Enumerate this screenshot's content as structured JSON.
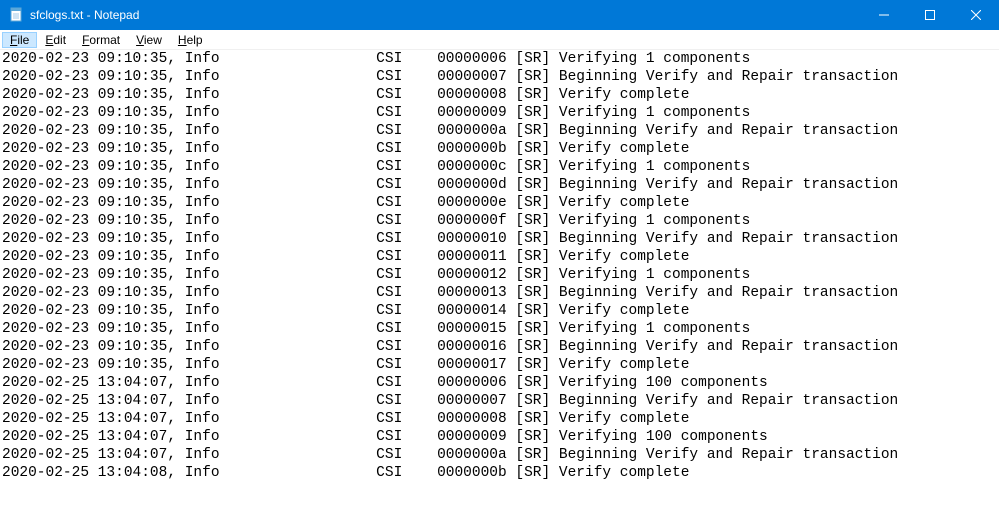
{
  "window": {
    "title": "sfclogs.txt - Notepad"
  },
  "menu": {
    "file": "File",
    "edit": "Edit",
    "format": "Format",
    "view": "View",
    "help": "Help"
  },
  "log_lines": [
    "2020-02-23 09:10:35, Info                  CSI    00000006 [SR] Verifying 1 components",
    "2020-02-23 09:10:35, Info                  CSI    00000007 [SR] Beginning Verify and Repair transaction",
    "2020-02-23 09:10:35, Info                  CSI    00000008 [SR] Verify complete",
    "2020-02-23 09:10:35, Info                  CSI    00000009 [SR] Verifying 1 components",
    "2020-02-23 09:10:35, Info                  CSI    0000000a [SR] Beginning Verify and Repair transaction",
    "2020-02-23 09:10:35, Info                  CSI    0000000b [SR] Verify complete",
    "2020-02-23 09:10:35, Info                  CSI    0000000c [SR] Verifying 1 components",
    "2020-02-23 09:10:35, Info                  CSI    0000000d [SR] Beginning Verify and Repair transaction",
    "2020-02-23 09:10:35, Info                  CSI    0000000e [SR] Verify complete",
    "2020-02-23 09:10:35, Info                  CSI    0000000f [SR] Verifying 1 components",
    "2020-02-23 09:10:35, Info                  CSI    00000010 [SR] Beginning Verify and Repair transaction",
    "2020-02-23 09:10:35, Info                  CSI    00000011 [SR] Verify complete",
    "2020-02-23 09:10:35, Info                  CSI    00000012 [SR] Verifying 1 components",
    "2020-02-23 09:10:35, Info                  CSI    00000013 [SR] Beginning Verify and Repair transaction",
    "2020-02-23 09:10:35, Info                  CSI    00000014 [SR] Verify complete",
    "2020-02-23 09:10:35, Info                  CSI    00000015 [SR] Verifying 1 components",
    "2020-02-23 09:10:35, Info                  CSI    00000016 [SR] Beginning Verify and Repair transaction",
    "2020-02-23 09:10:35, Info                  CSI    00000017 [SR] Verify complete",
    "2020-02-25 13:04:07, Info                  CSI    00000006 [SR] Verifying 100 components",
    "2020-02-25 13:04:07, Info                  CSI    00000007 [SR] Beginning Verify and Repair transaction",
    "2020-02-25 13:04:07, Info                  CSI    00000008 [SR] Verify complete",
    "2020-02-25 13:04:07, Info                  CSI    00000009 [SR] Verifying 100 components",
    "2020-02-25 13:04:07, Info                  CSI    0000000a [SR] Beginning Verify and Repair transaction",
    "2020-02-25 13:04:08, Info                  CSI    0000000b [SR] Verify complete"
  ]
}
